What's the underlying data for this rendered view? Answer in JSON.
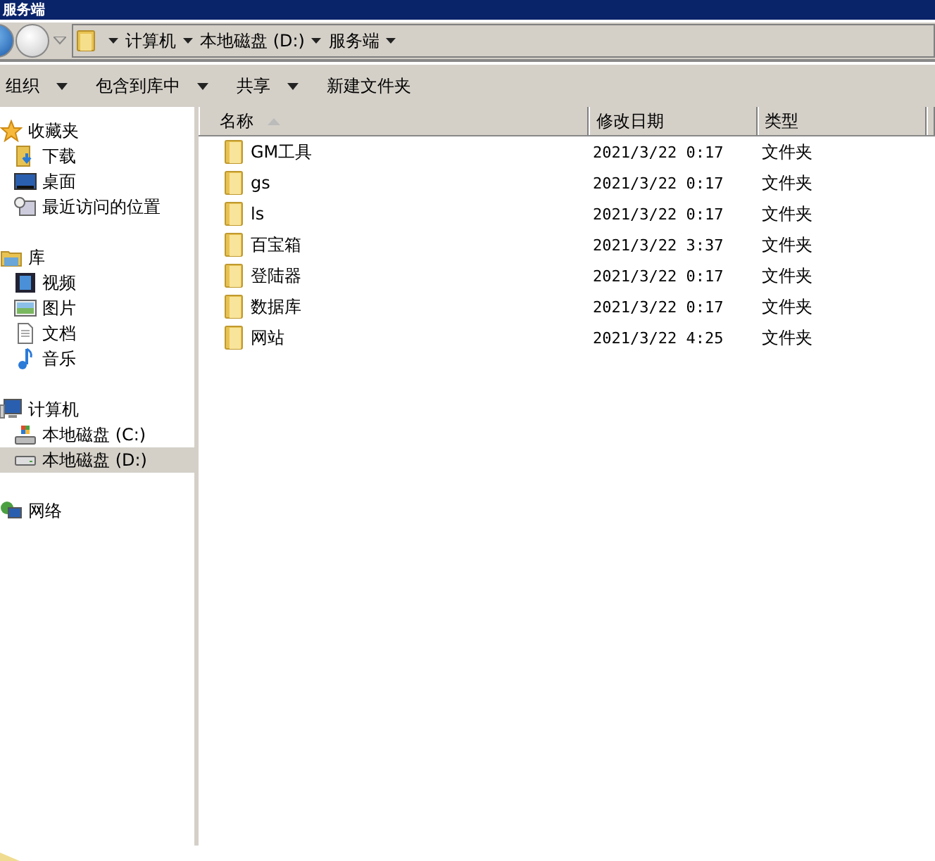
{
  "window": {
    "title": "服务端"
  },
  "address_bar": {
    "crumbs": [
      "计算机",
      "本地磁盘 (D:)",
      "服务端"
    ]
  },
  "toolbar": [
    {
      "label": "组织",
      "dropdown": true
    },
    {
      "label": "包含到库中",
      "dropdown": true
    },
    {
      "label": "共享",
      "dropdown": true
    },
    {
      "label": "新建文件夹",
      "dropdown": false
    }
  ],
  "sidebar": {
    "items": [
      {
        "label": "收藏夹",
        "kind": "star",
        "selected": false,
        "children": [
          {
            "label": "下载",
            "kind": "download",
            "selected": false
          },
          {
            "label": "桌面",
            "kind": "desktop",
            "selected": false
          },
          {
            "label": "最近访问的位置",
            "kind": "recent",
            "selected": false
          }
        ]
      },
      {
        "label": "库",
        "kind": "library",
        "selected": false,
        "children": [
          {
            "label": "视频",
            "kind": "video",
            "selected": false
          },
          {
            "label": "图片",
            "kind": "picture",
            "selected": false
          },
          {
            "label": "文档",
            "kind": "document",
            "selected": false
          },
          {
            "label": "音乐",
            "kind": "music",
            "selected": false
          }
        ]
      },
      {
        "label": "计算机",
        "kind": "computer",
        "selected": false,
        "children": [
          {
            "label": "本地磁盘 (C:)",
            "kind": "sysdrive",
            "selected": false
          },
          {
            "label": "本地磁盘 (D:)",
            "kind": "drive",
            "selected": true
          }
        ]
      },
      {
        "label": "网络",
        "kind": "network",
        "selected": false
      }
    ]
  },
  "table": {
    "columns": [
      {
        "label": "名称",
        "sorted": true
      },
      {
        "label": "修改日期",
        "sorted": false
      },
      {
        "label": "类型",
        "sorted": false
      }
    ],
    "rows": [
      {
        "name": "GM工具",
        "modified": "2021/3/22 0:17",
        "type": "文件夹"
      },
      {
        "name": "gs",
        "modified": "2021/3/22 0:17",
        "type": "文件夹"
      },
      {
        "name": "ls",
        "modified": "2021/3/22 0:17",
        "type": "文件夹"
      },
      {
        "name": "百宝箱",
        "modified": "2021/3/22 3:37",
        "type": "文件夹"
      },
      {
        "name": "登陆器",
        "modified": "2021/3/22 0:17",
        "type": "文件夹"
      },
      {
        "name": "数据库",
        "modified": "2021/3/22 0:17",
        "type": "文件夹"
      },
      {
        "name": "网站",
        "modified": "2021/3/22 4:25",
        "type": "文件夹"
      }
    ]
  }
}
